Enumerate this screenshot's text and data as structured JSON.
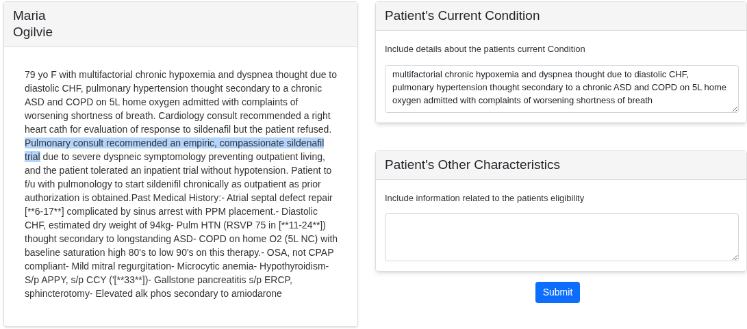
{
  "patient": {
    "name": "Maria Ogilvie",
    "summary": [
      {
        "text": "79 yo F with multifactorial chronic hypoxemia and dyspnea thought due to diastolic CHF, pulmonary hypertension thought secondary to a chronic ASD and COPD on 5L home oxygen admitted with complaints of worsening shortness of breath. Cardiology consult recommended a right heart cath for evaluation of response to sildenafil but the patient refused. ",
        "selected": false
      },
      {
        "text": "Pulmonary consult recommended an empiric, compassionate sildenafil trial",
        "selected": true
      },
      {
        "text": " due to severe dyspneic symptomology preventing outpatient living, and the patient tolerated an inpatient trial without hypotension. Patient to f/u with pulmonology to start sildenifil chronically as outpatient as prior authorization is obtained.Past Medical History:- Atrial septal defect repair [**6-17**] complicated by sinus arrest with PPM placement.- Diastolic CHF, estimated dry weight of 94kg- Pulm HTN (RSVP 75 in [**11-24**]) thought secondary to longstanding ASD- COPD on home O2 (5L NC) with baseline saturation high 80's to low 90's on this therapy.- OSA, not CPAP compliant- Mild mitral regurgitation- Microcytic anemia- Hypothyroidism- S/p APPY, s/p CCY ('[**33**])- Gallstone pancreatitis s/p ERCP, sphincterotomy- Elevated alk phos secondary to amiodarone",
        "selected": false
      }
    ]
  },
  "sections": [
    {
      "title": "Patient's Current Condition",
      "label": "Include details about the patients current Condition",
      "value": "multifactorial chronic hypoxemia and dyspnea thought due to diastolic CHF, pulmonary hypertension thought secondary to a chronic ASD and COPD on 5L home oxygen admitted with complaints of worsening shortness of breath"
    },
    {
      "title": "Patient's Other Characteristics",
      "label": "Include information related to the patients eligibility"
    }
  ],
  "submit": "Submit"
}
